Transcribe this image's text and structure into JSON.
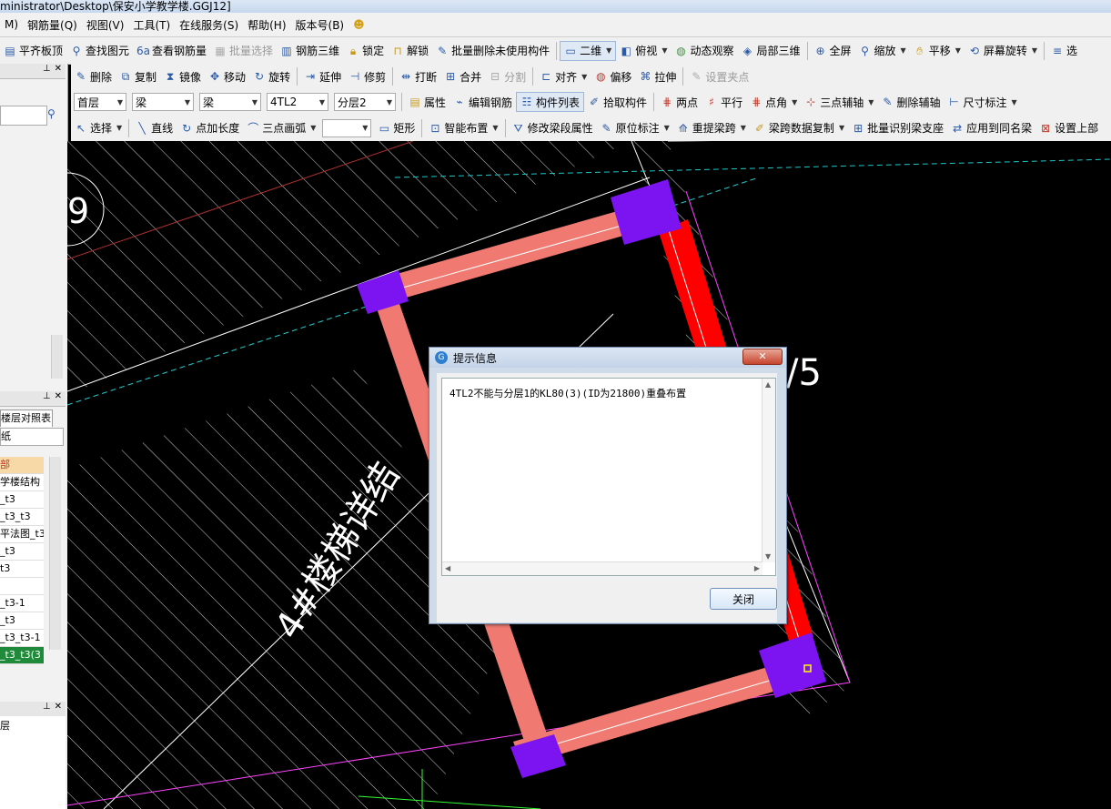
{
  "window": {
    "title": "ministrator\\Desktop\\保安小学教学楼.GGJ12]"
  },
  "menu": [
    "M)",
    "钢筋量(Q)",
    "视图(V)",
    "工具(T)",
    "在线服务(S)",
    "帮助(H)",
    "版本号(B)"
  ],
  "toolbar1": {
    "pingqi": "平齐板顶",
    "find": "查找图元",
    "view_rebar": "查看钢筋量",
    "batch_select": "批量选择",
    "rebar3d": "钢筋三维",
    "lock": "锁定",
    "unlock": "解锁",
    "batch_delete": "批量删除未使用构件",
    "view2d": "二维",
    "topview": "俯视",
    "dynamic": "动态观察",
    "local3d": "局部三维",
    "fullscreen": "全屏",
    "zoom": "缩放",
    "pan": "平移",
    "rotate_screen": "屏幕旋转",
    "select_more": "选"
  },
  "toolbar2": {
    "delete": "删除",
    "copy": "复制",
    "mirror": "镜像",
    "move": "移动",
    "rotate": "旋转",
    "extend": "延伸",
    "trim": "修剪",
    "break": "打断",
    "merge": "合并",
    "split": "分割",
    "align": "对齐",
    "offset": "偏移",
    "stretch": "拉伸",
    "set_grip": "设置夹点"
  },
  "toolbar3": {
    "floor": "首层",
    "category": "梁",
    "type": "梁",
    "component": "4TL2",
    "sublayer": "分层2",
    "props": "属性",
    "edit_rebar": "编辑钢筋",
    "component_list": "构件列表",
    "pick": "拾取构件",
    "two_points": "两点",
    "parallel": "平行",
    "point_angle": "点角",
    "three_point_axis": "三点辅轴",
    "delete_axis": "删除辅轴",
    "dimension": "尺寸标注"
  },
  "toolbar4": {
    "select": "选择",
    "line": "直线",
    "point_length": "点加长度",
    "three_arc": "三点画弧",
    "rect": "矩形",
    "smart": "智能布置",
    "modify_span": "修改梁段属性",
    "in_situ": "原位标注",
    "reextract": "重提梁跨",
    "copy_span": "梁跨数据复制",
    "batch_support": "批量识别梁支座",
    "apply_same": "应用到同名梁",
    "set_top": "设置上部"
  },
  "left": {
    "tab_label": "楼层对照表",
    "list_input": "纸",
    "list": [
      "部",
      "学楼结构",
      "_t3",
      "_t3_t3",
      "平法图_t3",
      "_t3",
      "t3",
      "",
      "_t3-1",
      "_t3",
      "_t3_t3-1",
      "_t3_t3(3"
    ],
    "bottom_item": "层"
  },
  "canvas": {
    "label_stair": "4#楼梯详结",
    "label_axis_left": "9",
    "label_axis_right": "/5",
    "colors": {
      "beam": "#f07a72",
      "column": "#7b14f0",
      "red_beam": "#ff0000",
      "hatch": "#ffffff"
    }
  },
  "dialog": {
    "title": "提示信息",
    "message": "4TL2不能与分层1的KL80(3)(ID为21800)重叠布置",
    "close_label": "关闭"
  }
}
